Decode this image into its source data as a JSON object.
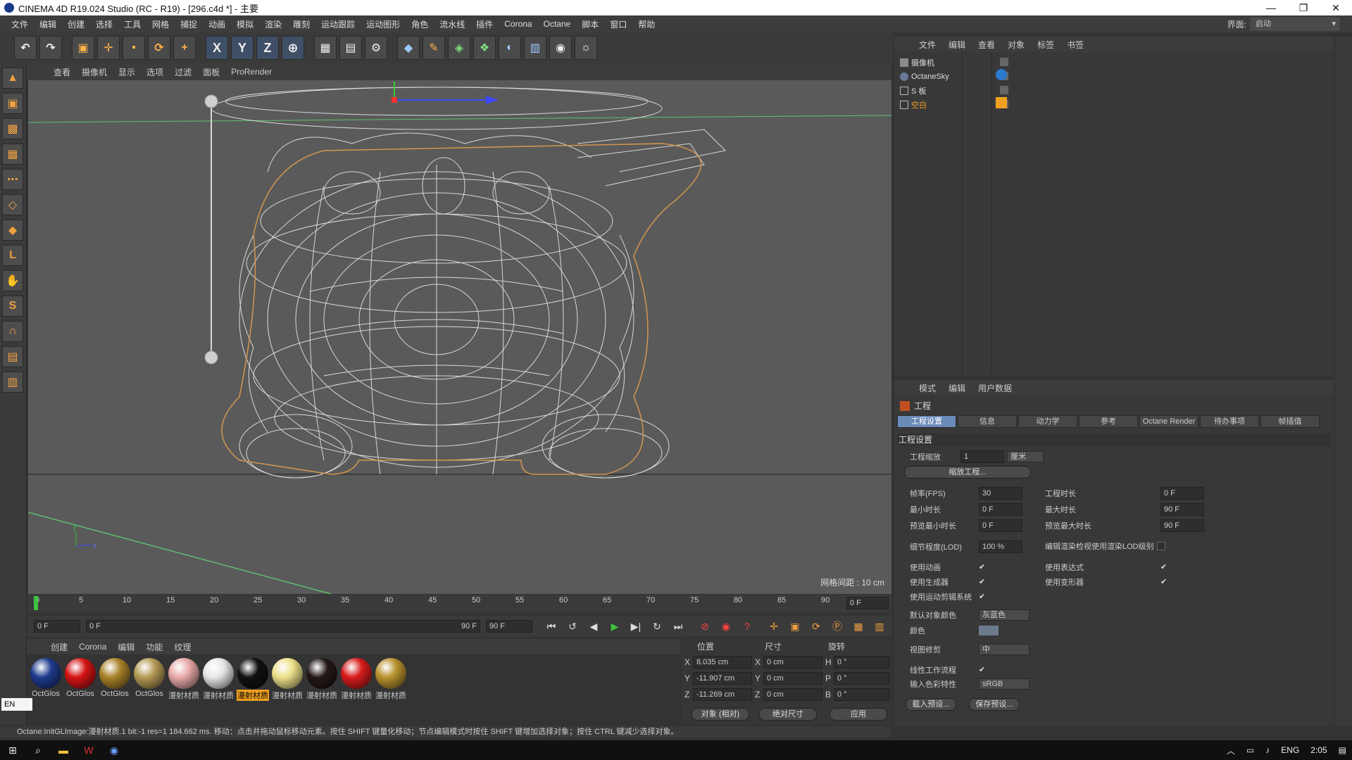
{
  "title": "CINEMA 4D R19.024 Studio (RC - R19) - [296.c4d *] - 主要",
  "window_buttons": [
    "—",
    "❐",
    "✕"
  ],
  "menu": [
    "文件",
    "编辑",
    "创建",
    "选择",
    "工具",
    "网格",
    "捕捉",
    "动画",
    "模拟",
    "渲染",
    "雕刻",
    "运动跟踪",
    "运动图形",
    "角色",
    "流水线",
    "插件",
    "Corona",
    "Octane",
    "脚本",
    "窗口",
    "帮助"
  ],
  "interface_label": "界面:",
  "interface_value": "启动",
  "toolbar_axes": [
    "X",
    "Y",
    "Z"
  ],
  "viewport_menu": [
    "查看",
    "摄像机",
    "显示",
    "选项",
    "过滤",
    "面板",
    "ProRender"
  ],
  "grid_spacing": "网格间距 : 10 cm",
  "timeline_ticks": [
    "0",
    "5",
    "10",
    "15",
    "20",
    "25",
    "30",
    "35",
    "40",
    "45",
    "50",
    "55",
    "60",
    "65",
    "70",
    "75",
    "80",
    "85",
    "90"
  ],
  "timeline_end": "0 F",
  "playbar": {
    "start": "0 F",
    "range_start": "0 F",
    "range_end": "90 F",
    "end": "90 F"
  },
  "material_menu": [
    "创建",
    "Corona",
    "编辑",
    "功能",
    "纹理"
  ],
  "materials": [
    {
      "label": "OctGlos",
      "color": "#1e3a8c"
    },
    {
      "label": "OctGlos",
      "color": "#d41414"
    },
    {
      "label": "OctGlos",
      "color": "#a9822a"
    },
    {
      "label": "OctGlos",
      "color": "#b59a55"
    },
    {
      "label": "漫射材质",
      "color": "#e8a8a8"
    },
    {
      "label": "漫射材质",
      "color": "#e6e6e6"
    },
    {
      "label": "漫射材质",
      "color": "#111111",
      "selected": true
    },
    {
      "label": "漫射材质",
      "color": "#ece08a"
    },
    {
      "label": "漫射材质",
      "color": "#241818"
    },
    {
      "label": "漫射材质",
      "color": "#d81c1c"
    },
    {
      "label": "漫射材质",
      "color": "#b8922e"
    }
  ],
  "coord": {
    "headers": [
      "位置",
      "尺寸",
      "旋转"
    ],
    "rows": [
      {
        "axis": "X",
        "pos": "8.035 cm",
        "size_axis": "X",
        "size": "0 cm",
        "rot_axis": "H",
        "rot": "0 °"
      },
      {
        "axis": "Y",
        "pos": "-11.907 cm",
        "size_axis": "Y",
        "size": "0 cm",
        "rot_axis": "P",
        "rot": "0 °"
      },
      {
        "axis": "Z",
        "pos": "-11.269 cm",
        "size_axis": "Z",
        "size": "0 cm",
        "rot_axis": "B",
        "rot": "0 °"
      }
    ],
    "mode1": "对象 (相对)",
    "mode2": "绝对尺寸",
    "apply": "应用"
  },
  "object_menu": [
    "文件",
    "编辑",
    "查看",
    "对象",
    "标签",
    "书签"
  ],
  "objects": [
    {
      "name": "摄像机",
      "color": "#dddddd"
    },
    {
      "name": "OctaneSky",
      "color": "#dddddd"
    },
    {
      "name": "S 板",
      "color": "#dddddd"
    },
    {
      "name": "空白",
      "color": "#f0a020"
    }
  ],
  "attr_menu": [
    "模式",
    "编辑",
    "用户数据"
  ],
  "attr_title": "工程",
  "attr_tabs": [
    "工程设置",
    "信息",
    "动力学",
    "参考",
    "Octane Render",
    "待办事项",
    "帧插值"
  ],
  "attr_section": "工程设置",
  "attrs": {
    "scale_label": "工程缩放",
    "scale_value": "1",
    "scale_unit": "厘米",
    "scale_button": "缩放工程...",
    "fps_label": "帧率(FPS)",
    "fps_value": "30",
    "proj_time_label": "工程时长",
    "proj_time_value": "0 F",
    "min_time_label": "最小时长",
    "min_time_value": "0 F",
    "max_time_label": "最大时长",
    "max_time_value": "90 F",
    "prev_min_label": "预览最小时长",
    "prev_min_value": "0 F",
    "prev_max_label": "预览最大时长",
    "prev_max_value": "90 F",
    "lod_label": "细节程度(LOD)",
    "lod_value": "100 %",
    "lod_render_label": "编辑渲染检视使用渲染LOD级别",
    "use_anim": "使用动画",
    "use_expr": "使用表达式",
    "use_gen": "使用生成器",
    "use_deform": "使用变形器",
    "use_motion": "使用运动剪辑系统",
    "default_color_label": "默认对象颜色",
    "default_color_value": "灰蓝色",
    "color_label": "颜色",
    "view_clip_label": "视图修剪",
    "view_clip_value": "中",
    "linear_label": "线性工作流程",
    "input_color_label": "输入色彩特性",
    "input_color_value": "sRGB",
    "load_preset": "载入预设...",
    "save_preset": "保存预设..."
  },
  "status": "Octane:InitGLImage:漫射材质.1  bit:-1 res=1  184.662 ms.   移动：点击并拖动鼠标移动元素。按住 SHIFT 键量化移动；节点编辑模式时按住 SHIFT 键增加选择对象；按住 CTRL 键减少选择对象。",
  "lang": "EN",
  "taskbar": {
    "ime": "ENG",
    "time": "2:05"
  }
}
